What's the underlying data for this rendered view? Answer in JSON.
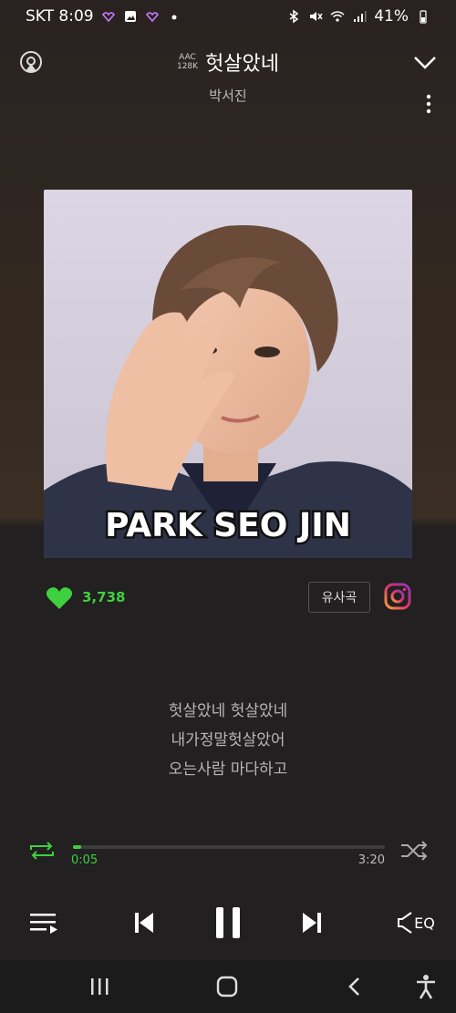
{
  "status": {
    "carrier_time": "SKT 8:09",
    "battery": "41%"
  },
  "player": {
    "codec_line1": "AAC",
    "codec_line2": "128K",
    "title": "헛살았네",
    "artist": "박서진"
  },
  "album_art": {
    "caption": "PARK SEO JIN"
  },
  "meta": {
    "like_count": "3,738",
    "similar_label": "유사곡"
  },
  "lyrics": {
    "lines": [
      "헛살았네 헛살았네",
      "내가정말헛살았어",
      "오는사람 마다하고"
    ]
  },
  "progress": {
    "current": "0:05",
    "total": "3:20",
    "fraction": 0.025
  },
  "controls": {
    "eq_label": "EQ"
  },
  "colors": {
    "accent": "#3fd03f"
  }
}
